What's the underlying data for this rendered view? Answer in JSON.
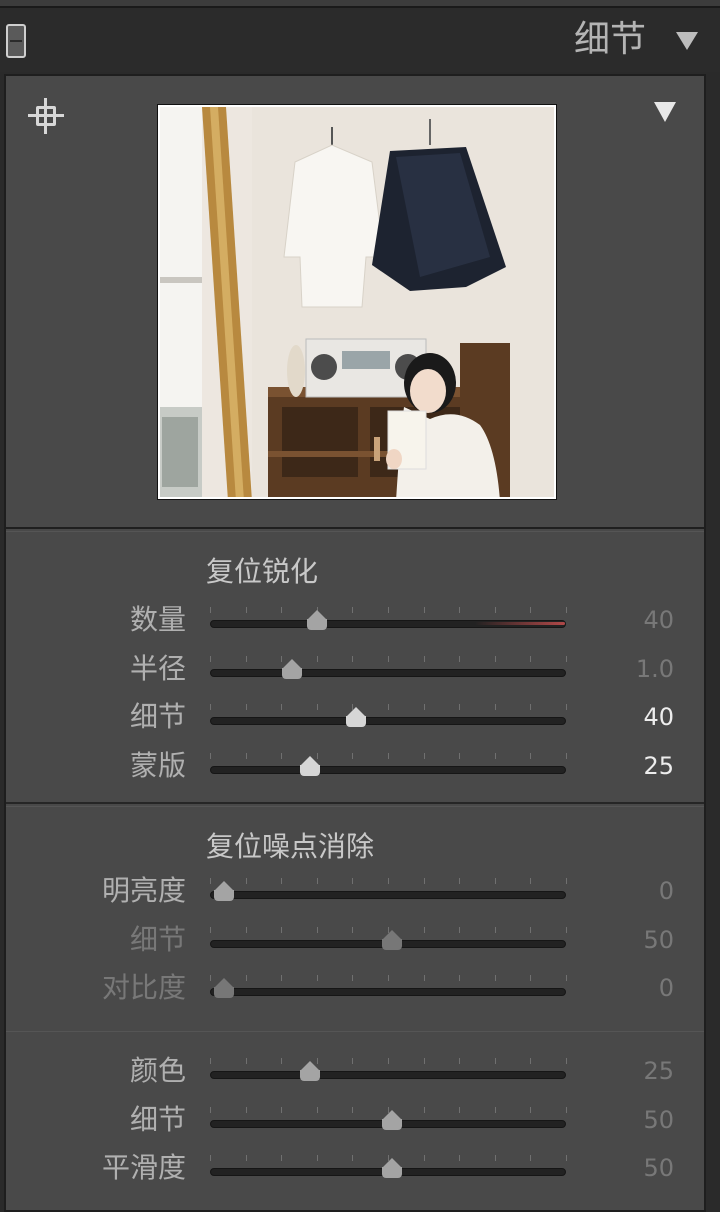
{
  "header": {
    "title": "细节"
  },
  "sharpening": {
    "title": "复位锐化",
    "rows": [
      {
        "label": "数量",
        "value": "40",
        "pos": 0.3,
        "tone": "dim",
        "labelTone": "mid"
      },
      {
        "label": "半径",
        "value": "1.0",
        "pos": 0.23,
        "tone": "dim",
        "labelTone": "mid"
      },
      {
        "label": "细节",
        "value": "40",
        "pos": 0.41,
        "tone": "bright",
        "labelTone": "mid"
      },
      {
        "label": "蒙版",
        "value": "25",
        "pos": 0.28,
        "tone": "bright",
        "labelTone": "mid"
      }
    ]
  },
  "noise": {
    "title": "复位噪点消除",
    "luminance_rows": [
      {
        "label": "明亮度",
        "value": "0",
        "pos": 0.04,
        "tone": "dim",
        "labelTone": "mid"
      },
      {
        "label": "细节",
        "value": "50",
        "pos": 0.51,
        "tone": "dim",
        "labelTone": "dim"
      },
      {
        "label": "对比度",
        "value": "0",
        "pos": 0.04,
        "tone": "dim",
        "labelTone": "dim"
      }
    ],
    "color_rows": [
      {
        "label": "颜色",
        "value": "25",
        "pos": 0.28,
        "tone": "dim",
        "labelTone": "mid"
      },
      {
        "label": "细节",
        "value": "50",
        "pos": 0.51,
        "tone": "dim",
        "labelTone": "mid"
      },
      {
        "label": "平滑度",
        "value": "50",
        "pos": 0.51,
        "tone": "dim",
        "labelTone": "mid"
      }
    ]
  }
}
